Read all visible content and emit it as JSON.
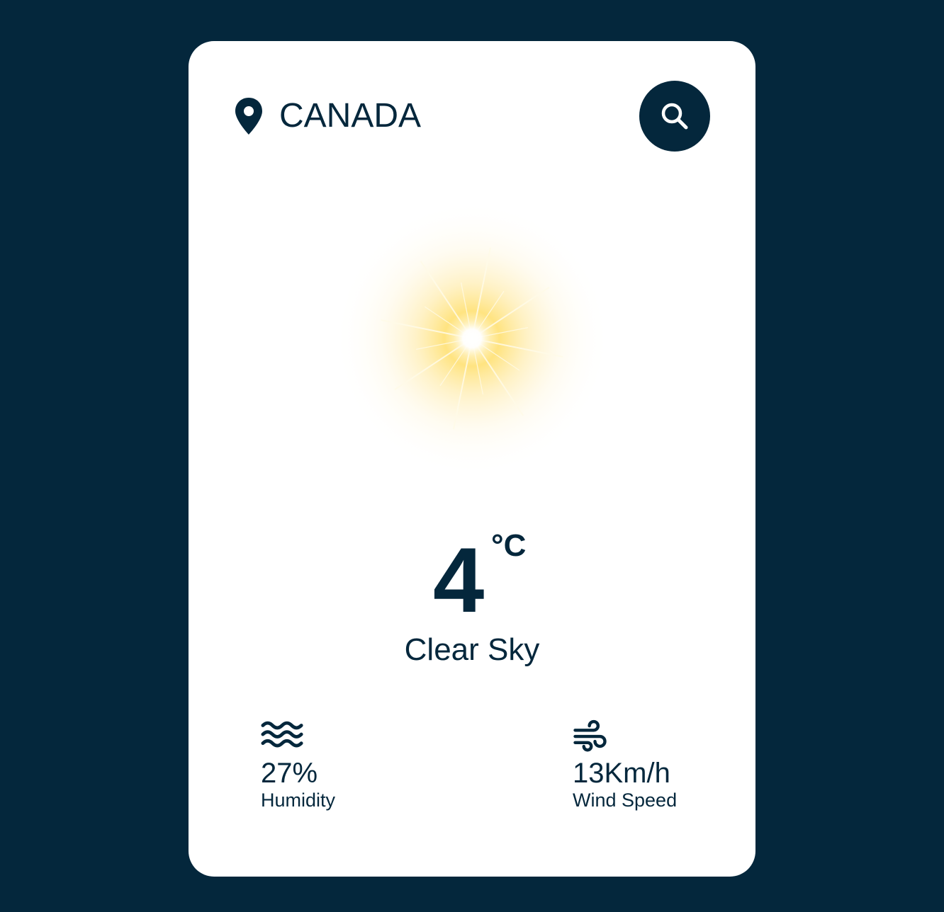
{
  "colors": {
    "background": "#04273c",
    "card": "#ffffff",
    "text": "#04273c",
    "sun_glow": "#ffd966"
  },
  "header": {
    "location_icon": "map-pin-icon",
    "location": "CANADA",
    "search_icon": "search-icon"
  },
  "weather": {
    "icon": "clear-sky-sun-icon",
    "temperature": "4",
    "unit": "°C",
    "condition": "Clear Sky"
  },
  "details": {
    "humidity": {
      "icon": "humidity-waves-icon",
      "value": "27%",
      "label": "Humidity"
    },
    "wind": {
      "icon": "wind-icon",
      "value": "13Km/h",
      "label": "Wind Speed"
    }
  }
}
